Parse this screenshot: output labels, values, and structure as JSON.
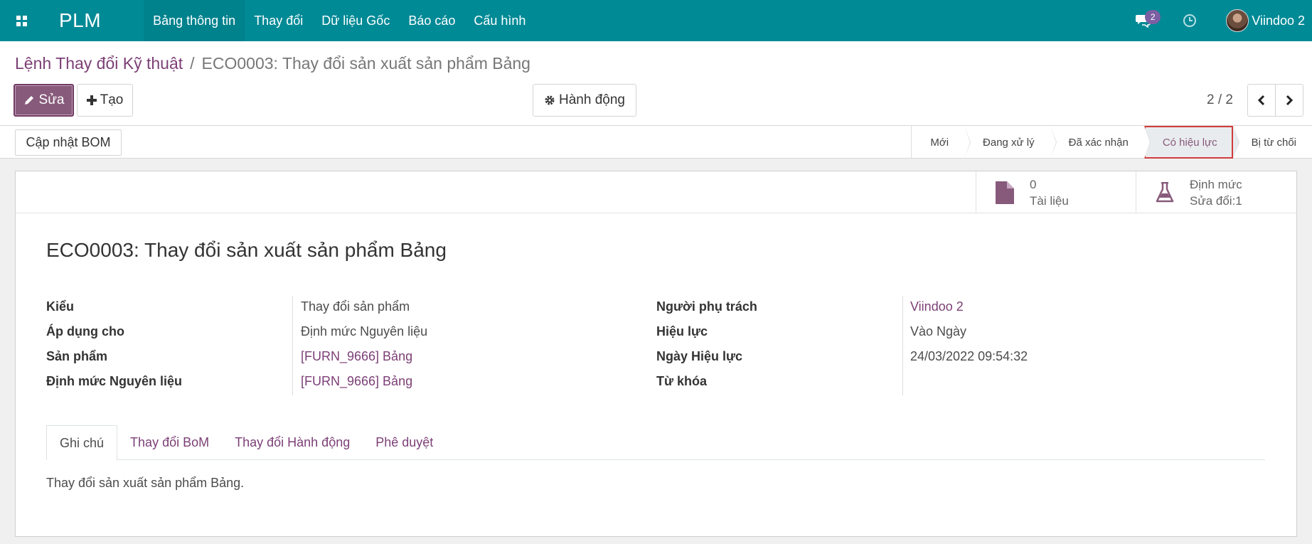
{
  "navbar": {
    "brand": "PLM",
    "menu": [
      "Bảng thông tin",
      "Thay đổi",
      "Dữ liệu Gốc",
      "Báo cáo",
      "Cấu hình"
    ],
    "chat_count": "2",
    "user_name": "Viindoo 2"
  },
  "breadcrumb": {
    "parent": "Lệnh Thay đổi Kỹ thuật",
    "separator": "/",
    "current": "ECO0003: Thay đổi sản xuất sản phẩm Bảng"
  },
  "toolbar": {
    "edit_label": "Sửa",
    "create_label": "Tạo",
    "action_label": "Hành động",
    "pager": "2 / 2"
  },
  "statusbar": {
    "update_bom_label": "Cập nhật BOM",
    "stages": [
      "Mới",
      "Đang xử lý",
      "Đã xác nhận",
      "Có hiệu lực",
      "Bị từ chối"
    ],
    "active_stage": "Có hiệu lực"
  },
  "smart_buttons": {
    "documents": {
      "value": "0",
      "label": "Tài liệu"
    },
    "bom": {
      "value": "Định mức",
      "label": "Sửa đổi:1"
    }
  },
  "record": {
    "title": "ECO0003: Thay đổi sản xuất sản phẩm Bảng",
    "left_fields": [
      {
        "label": "Kiểu",
        "value": "Thay đổi sản phẩm"
      },
      {
        "label": "Áp dụng cho",
        "value": "Định mức Nguyên liệu"
      },
      {
        "label": "Sản phẩm",
        "value": "[FURN_9666] Bảng"
      },
      {
        "label": "Định mức Nguyên liệu",
        "value": "[FURN_9666] Bảng"
      }
    ],
    "right_fields": [
      {
        "label": "Người phụ trách",
        "value": "Viindoo 2"
      },
      {
        "label": "Hiệu lực",
        "value": "Vào Ngày"
      },
      {
        "label": "Ngày Hiệu lực",
        "value": "24/03/2022 09:54:32"
      },
      {
        "label": "Từ khóa",
        "value": ""
      }
    ]
  },
  "tabs": [
    "Ghi chú",
    "Thay đổi BoM",
    "Thay đổi Hành động",
    "Phê duyệt"
  ],
  "note": "Thay đổi sản xuất sản phẩm Bảng.",
  "colors": {
    "navbar": "#008a96",
    "primary": "#875a7b",
    "link": "#7c3f76",
    "active_stage_border": "#d13d3d"
  }
}
